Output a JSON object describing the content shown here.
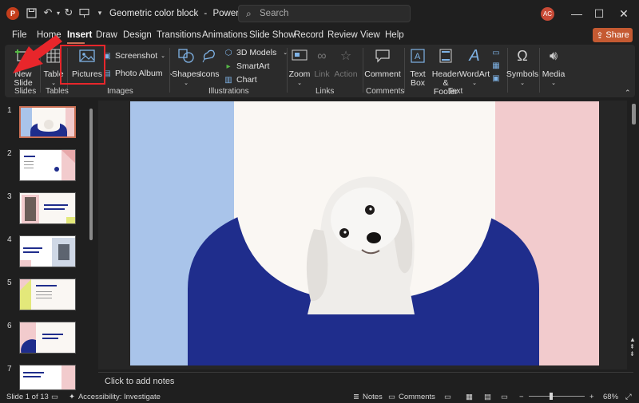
{
  "titlebar": {
    "document_title": "Geometric color block",
    "separator": "-",
    "app_name": "PowerPoint",
    "search_placeholder": "Search",
    "avatar_initials": "AC",
    "app_logo_letter": "P"
  },
  "tabs": [
    "File",
    "Home",
    "Insert",
    "Draw",
    "Design",
    "Transitions",
    "Animations",
    "Slide Show",
    "Record",
    "Review",
    "View",
    "Help"
  ],
  "active_tab": "Insert",
  "share_label": "Share",
  "ribbon": {
    "new_slide": {
      "line1": "New",
      "line2": "Slide"
    },
    "table": "Table",
    "pictures": "Pictures",
    "screenshot": "Screenshot",
    "photo_album": "Photo Album",
    "shapes": "Shapes",
    "icons": "Icons",
    "models_3d": "3D Models",
    "smartart": "SmartArt",
    "chart": "Chart",
    "zoom": "Zoom",
    "link": "Link",
    "action": "Action",
    "comment": "Comment",
    "text_box": {
      "line1": "Text",
      "line2": "Box"
    },
    "header_footer": {
      "line1": "Header",
      "line2": "& Footer"
    },
    "wordart": "WordArt",
    "symbols": "Symbols",
    "media": "Media",
    "groups": {
      "slides": "Slides",
      "tables": "Tables",
      "images": "Images",
      "illustrations": "Illustrations",
      "links": "Links",
      "comments": "Comments",
      "text": "Text"
    }
  },
  "thumbnails": [
    {
      "num": "1"
    },
    {
      "num": "2"
    },
    {
      "num": "3"
    },
    {
      "num": "4"
    },
    {
      "num": "5"
    },
    {
      "num": "6"
    },
    {
      "num": "7"
    }
  ],
  "notes_placeholder": "Click to add notes",
  "status": {
    "slide_of": "Slide 1 of 13",
    "accessibility": "Accessibility: Investigate",
    "notes": "Notes",
    "comments": "Comments",
    "zoom_level": "68%"
  },
  "colors": {
    "slide_blue": "#1f2d8c",
    "slide_light_blue": "#a9c4ea",
    "slide_pink": "#f2cbcd",
    "accent": "#c55a32",
    "highlight_red": "#e8262b"
  }
}
